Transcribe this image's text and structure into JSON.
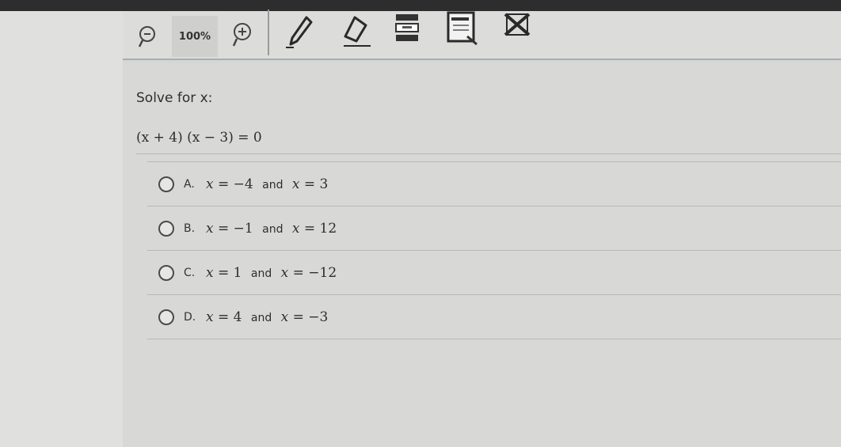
{
  "toolbar": {
    "zoom_label": "100%"
  },
  "question": {
    "prompt": "Solve for x:",
    "equation": "(x + 4) (x − 3) = 0",
    "options": [
      {
        "letter": "A.",
        "var1": "x",
        "eq1": "= −4",
        "and": "and",
        "var2": "x",
        "eq2": "= 3"
      },
      {
        "letter": "B.",
        "var1": "x",
        "eq1": "= −1",
        "and": "and",
        "var2": "x",
        "eq2": "= 12"
      },
      {
        "letter": "C.",
        "var1": "x",
        "eq1": "= 1",
        "and": "and",
        "var2": "x",
        "eq2": "= −12"
      },
      {
        "letter": "D.",
        "var1": "x",
        "eq1": "= 4",
        "and": "and",
        "var2": "x",
        "eq2": "= −3"
      }
    ]
  },
  "icons": [
    "zoom-out-icon",
    "zoom-in-icon",
    "pen-icon",
    "eraser-icon",
    "line-reader-icon",
    "notepad-icon",
    "answer-eliminator-icon"
  ]
}
